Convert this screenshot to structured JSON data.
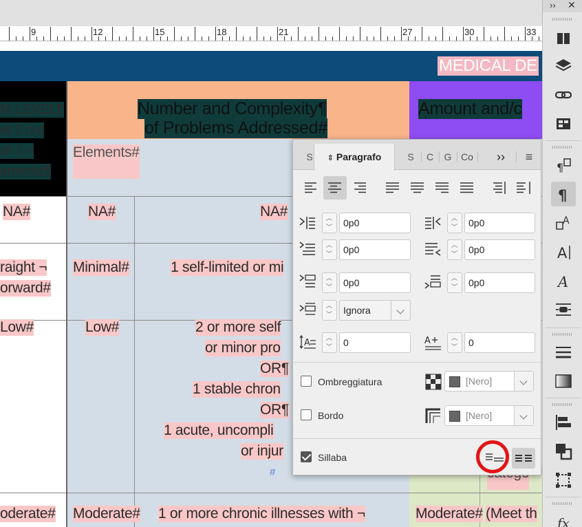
{
  "ruler": {
    "numbers": [
      "9",
      "12",
      "15",
      "18",
      "21",
      "27",
      "30",
      "33"
    ]
  },
  "document": {
    "banner_text": "MEDICAL DE",
    "header_left": [
      "M LEVEL¶",
      "et 2 out",
      "of 3 ¬",
      "ements¶"
    ],
    "header_problems": [
      "Number and Complexity¶",
      "of Problems Addressed#"
    ],
    "header_amount": "Amount and/c",
    "elements_text": "Elements#",
    "rows": {
      "na": [
        "NA#",
        "NA#",
        "NA#"
      ],
      "straight": [
        "raight ¬",
        "orward#",
        "Minimal#",
        "1 self-limited or mi"
      ],
      "low": [
        "Low#",
        "Low#",
        "2 or more self",
        "or minor pro",
        "OR¶",
        "1 stable chron",
        "OR¶",
        "1 acute, uncompli",
        "or injur",
        "#"
      ],
      "right_fragment": "catego",
      "moderate": [
        "oderate#",
        "Moderate#",
        "1 or more chronic illnesses with ¬",
        "Moderate#",
        "(Meet th"
      ]
    }
  },
  "panel": {
    "tabs": [
      "S",
      "Paragrafo",
      "S",
      "C",
      "G",
      "Co"
    ],
    "more_label": "››",
    "menu_label": "≡",
    "indent_left": "0p0",
    "indent_right": "0p0",
    "first_line": "0p0",
    "last_line": "0p0",
    "space_before": "0p0",
    "space_after": "0p0",
    "align_grid": "Ignora",
    "dropcap_lines": "0",
    "dropcap_chars": "0",
    "shading": {
      "label": "Ombreggiatura",
      "checked": false,
      "color": "[Nero]"
    },
    "border": {
      "label": "Bordo",
      "checked": false,
      "color": "[Nero]"
    },
    "hyphenate": {
      "label": "Sillaba",
      "checked": true
    }
  },
  "dock": {
    "header": "›› ✕",
    "fx": "fx"
  },
  "colors": {
    "banner": "#0d4b7a",
    "peach": "#f9b48a",
    "purple": "#8e4cf3",
    "cell_gray": "#d3dde7",
    "green": "#dde8c6",
    "highlight": "#f9c7c7",
    "annotation": "#e31515"
  }
}
